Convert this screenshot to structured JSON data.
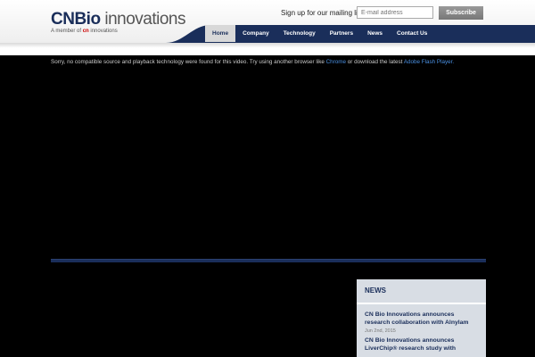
{
  "header": {
    "logo": {
      "cn": "CN",
      "bio": "Bio",
      "innovations": "innovations",
      "tagline_prefix": "A member of",
      "tagline_brand": "cn",
      "tagline_suffix": "innovations"
    },
    "mailing_label": "Sign up for our mailing list",
    "email_placeholder": "E-mail address",
    "subscribe_label": "Subscribe"
  },
  "nav": {
    "items": [
      {
        "label": "Home",
        "active": true
      },
      {
        "label": "Company",
        "active": false
      },
      {
        "label": "Technology",
        "active": false
      },
      {
        "label": "Partners",
        "active": false
      },
      {
        "label": "News",
        "active": false
      },
      {
        "label": "Contact Us",
        "active": false
      }
    ]
  },
  "video": {
    "message_prefix": "Sorry, no compatible source and playback technology were found for this video. Try using another browser like",
    "chrome_link": "Chrome",
    "message_middle": "or download the latest",
    "flash_link": "Adobe Flash Player."
  },
  "news": {
    "title": "NEWS",
    "items": [
      {
        "headline": "CN Bio Innovations announces research collaboration with Alnylam",
        "date": "Jun 2nd, 2015"
      },
      {
        "headline": "CN Bio Innovations announces LiverChip® research study with",
        "date": ""
      }
    ]
  },
  "colors": {
    "nav_bg": "#1a2e5a",
    "link": "#4a90e2",
    "news_bg": "#d8dde4"
  }
}
